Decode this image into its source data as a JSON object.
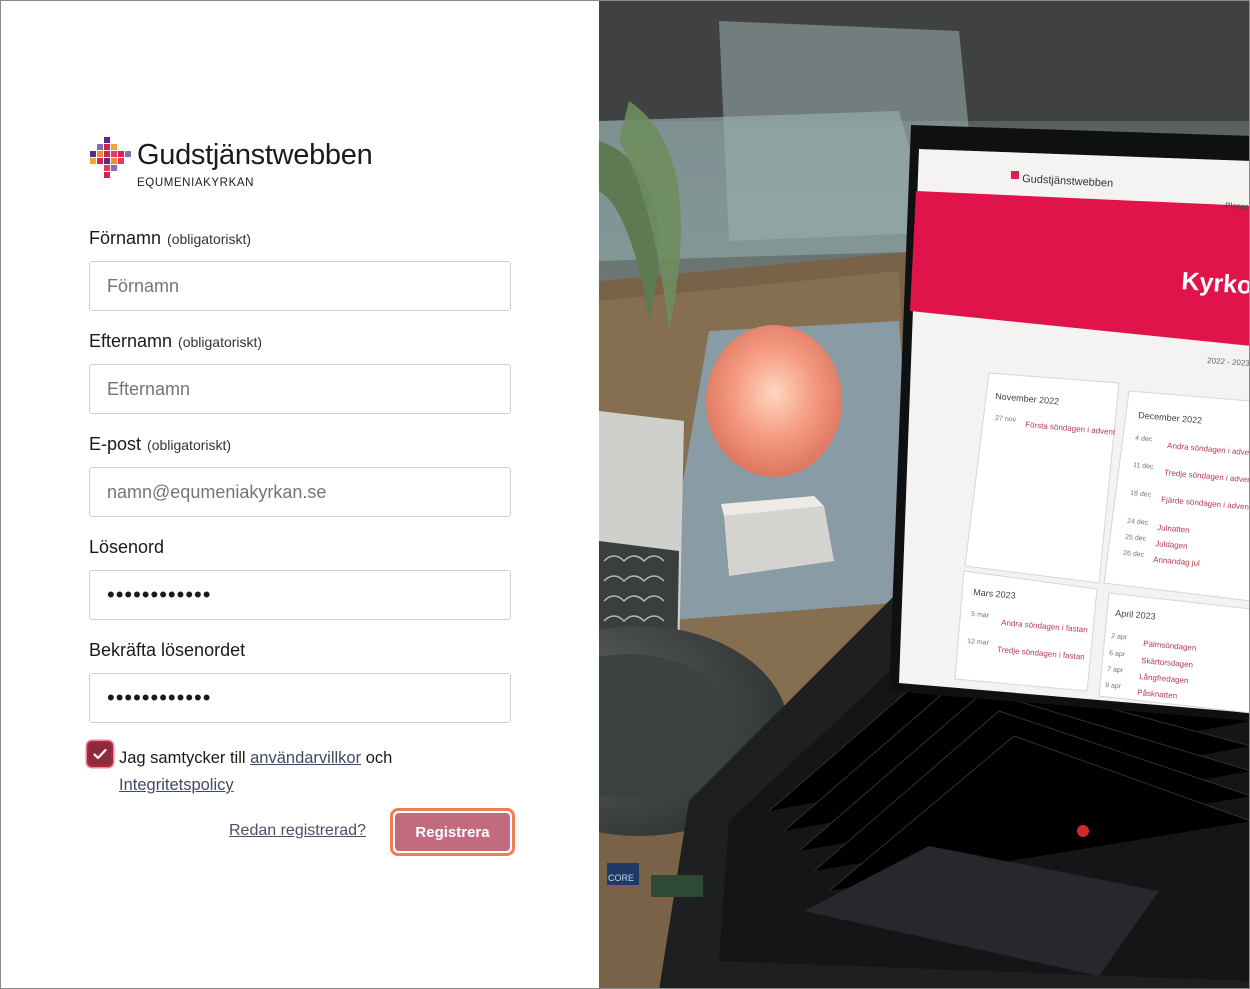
{
  "brand": {
    "title": "Gudstjänstwebben",
    "subtitle": "EQUMENIAKYRKAN"
  },
  "form": {
    "required_suffix": "(obligatoriskt)",
    "first_name": {
      "label": "Förnamn",
      "placeholder": "Förnamn",
      "value": ""
    },
    "last_name": {
      "label": "Efternamn",
      "placeholder": "Efternamn",
      "value": ""
    },
    "email": {
      "label": "E-post",
      "placeholder": "namn@equmeniakyrkan.se",
      "value": ""
    },
    "password": {
      "label": "Lösenord",
      "value": "••••••••••••"
    },
    "password_confirm": {
      "label": "Bekräfta lösenordet",
      "value": "••••••••••••"
    },
    "consent": {
      "checked": true,
      "prefix": "Jag samtycker till",
      "terms_link": "användarvillkor",
      "joiner": "och",
      "privacy_link": "Integritetspolicy"
    },
    "already_registered_link": "Redan registrerad?",
    "submit_label": "Registrera"
  },
  "photo": {
    "screen_brand": "Gudstjänstwebben",
    "screen_banner": "Kyrko",
    "screen_nav": "Planer",
    "screen_year": "2022 - 2023",
    "calendar": [
      {
        "month": "November 2022",
        "entries": [
          {
            "date": "27 nov",
            "name": "Första söndagen i advent"
          }
        ]
      },
      {
        "month": "December 2022",
        "entries": [
          {
            "date": "4 dec",
            "name": "Andra söndagen i advent"
          },
          {
            "date": "11 dec",
            "name": "Tredje söndagen i advent"
          },
          {
            "date": "18 dec",
            "name": "Fjärde söndagen i advent"
          },
          {
            "date": "24 dec",
            "name": "Julnatten"
          },
          {
            "date": "25 dec",
            "name": "Juldagen"
          },
          {
            "date": "26 dec",
            "name": "Annandag jul"
          }
        ]
      },
      {
        "month": "Mars 2023",
        "entries": [
          {
            "date": "5 mar",
            "name": "Andra söndagen i fastan"
          },
          {
            "date": "12 mar",
            "name": "Tredje söndagen i fastan"
          }
        ]
      },
      {
        "month": "April 2023",
        "entries": [
          {
            "date": "2 apr",
            "name": "Palmsöndagen"
          },
          {
            "date": "6 apr",
            "name": "Skärtorsdagen"
          },
          {
            "date": "7 apr",
            "name": "Långfredagen"
          },
          {
            "date": "9 apr",
            "name": "Påsknatten"
          }
        ]
      }
    ],
    "sticker_text": "CORE"
  },
  "colors": {
    "brand_red": "#e0144a",
    "checkbox": "#8e2a3c",
    "button": "#c26a7e",
    "button_focus": "#ef7d55"
  }
}
